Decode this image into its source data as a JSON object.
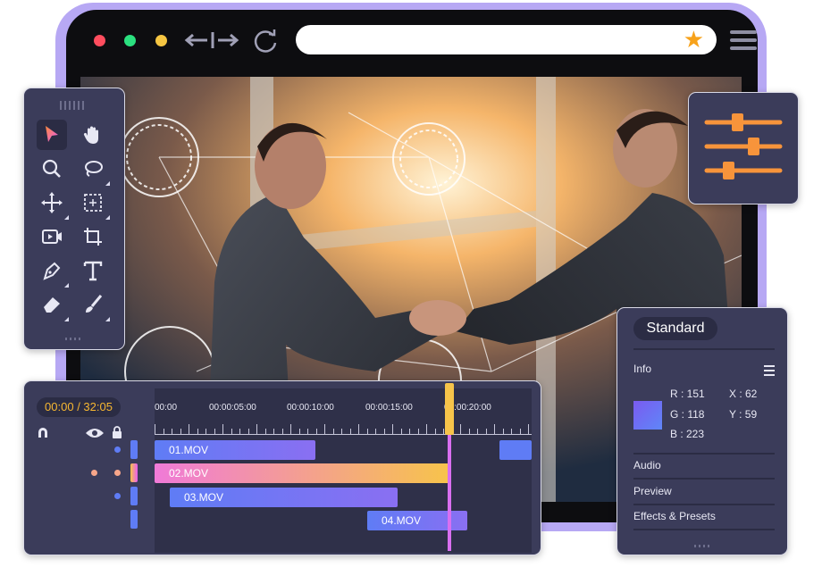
{
  "browser": {
    "window_controls": [
      "close",
      "maximize",
      "minimize"
    ],
    "nav": {
      "back_icon": "back-arrow-icon",
      "forward_icon": "forward-arrow-icon",
      "reload_icon": "reload-icon"
    },
    "url": "",
    "bookmark_icon": "star-icon",
    "menu_icon": "hamburger-menu-icon"
  },
  "tools_panel": {
    "tools": [
      {
        "name": "select",
        "icon": "arrow-cursor-icon",
        "active": true
      },
      {
        "name": "hand",
        "icon": "hand-icon"
      },
      {
        "name": "zoom",
        "icon": "magnifier-icon"
      },
      {
        "name": "lasso",
        "icon": "lasso-icon"
      },
      {
        "name": "move",
        "icon": "move-icon"
      },
      {
        "name": "marquee",
        "icon": "marquee-icon"
      },
      {
        "name": "video",
        "icon": "video-icon"
      },
      {
        "name": "crop",
        "icon": "crop-icon"
      },
      {
        "name": "pen",
        "icon": "pen-icon"
      },
      {
        "name": "text",
        "icon": "text-icon"
      },
      {
        "name": "eraser",
        "icon": "eraser-icon"
      },
      {
        "name": "brush",
        "icon": "brush-icon"
      }
    ]
  },
  "adjust_panel": {
    "icon": "sliders-icon",
    "accent": "#f7943b"
  },
  "info_panel": {
    "mode": "Standard",
    "section": "Info",
    "color": {
      "r": "R : 151",
      "g": "G : 118",
      "b": "B : 223",
      "x": "X : 62",
      "y": "Y : 59"
    },
    "links": [
      "Audio",
      "Preview",
      "Effects & Presets"
    ]
  },
  "timeline": {
    "timecode": "00:00 / 32:05",
    "ruler": [
      "00:00",
      "00:00:05:00",
      "00:00:10:00",
      "00:00:15:00",
      "00:00:20:00"
    ],
    "clips": [
      "01.MOV",
      "02.MOV",
      "03.MOV",
      "04.MOV"
    ],
    "colors": {
      "blue": "#5f7cf5",
      "pink": "#f07ad8",
      "yellow": "#f7c44a",
      "playhead": "#d96ff0"
    }
  }
}
